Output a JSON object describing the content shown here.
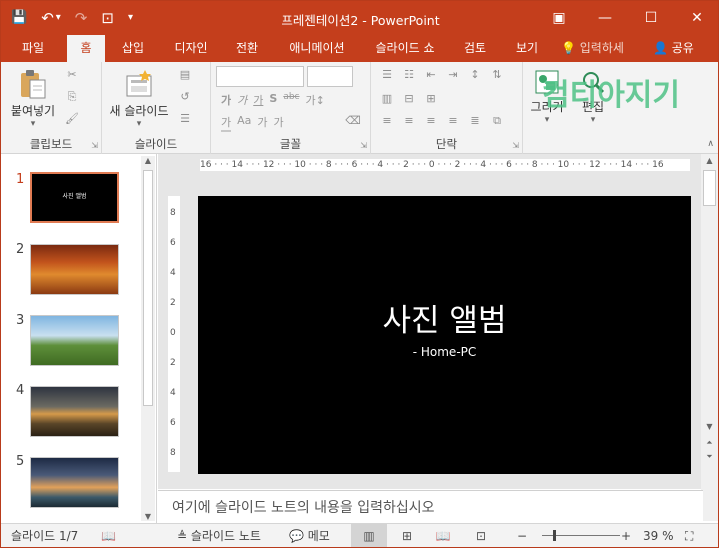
{
  "window": {
    "title": "프레젠테이션2  -  PowerPoint",
    "controls": {
      "restore_ribbon": "▣",
      "minimize": "—",
      "maximize": "☐",
      "close": "✕"
    }
  },
  "qat": {
    "save": "💾",
    "undo": "↶",
    "undo_dd": "▾",
    "redo": "↷",
    "present": "⊡",
    "customize": "▾"
  },
  "tabs": [
    {
      "label": "파일"
    },
    {
      "label": "홈"
    },
    {
      "label": "삽입"
    },
    {
      "label": "디자인"
    },
    {
      "label": "전환"
    },
    {
      "label": "애니메이션"
    },
    {
      "label": "슬라이드 쇼"
    },
    {
      "label": "검토"
    },
    {
      "label": "보기"
    }
  ],
  "tellme": "💡 입력하세",
  "share": "👤 공유",
  "ribbon": {
    "clipboard": {
      "label": "클립보드",
      "paste_label": "붙여넣기"
    },
    "slides": {
      "label": "슬라이드",
      "new_slide_label": "새 슬라이드"
    },
    "font": {
      "label": "글꼴",
      "row1": [
        "가",
        "가",
        "가",
        "S",
        "abc",
        "가↕"
      ],
      "row2": [
        "가",
        "Aa",
        "가",
        "가"
      ]
    },
    "paragraph": {
      "label": "단락"
    },
    "drawing": {
      "draw_label": "그리기",
      "edit_label": "편집"
    }
  },
  "thumbnails": [
    {
      "num": "1",
      "selected": true,
      "kind": "title",
      "text": "사진 앨범"
    },
    {
      "num": "2",
      "selected": false,
      "kind": "autumn"
    },
    {
      "num": "3",
      "selected": false,
      "kind": "field"
    },
    {
      "num": "4",
      "selected": false,
      "kind": "sunset"
    },
    {
      "num": "5",
      "selected": false,
      "kind": "clouds"
    }
  ],
  "ruler": {
    "h": "16 · · · 14 · · · 12 · · · 10 · · · 8 · · · 6 · · · 4 · · · 2 · · · 0 · · · 2 · · · 4 · · · 6 · · · 8 · · · 10 · · · 12 · · · 14 · · · 16",
    "v": [
      "8",
      "6",
      "4",
      "2",
      "0",
      "2",
      "4",
      "6",
      "8"
    ]
  },
  "slide": {
    "title": "사진 앨범",
    "subtitle": "- Home-PC"
  },
  "notes_placeholder": "여기에 슬라이드 노트의 내용을 입력하십시오",
  "status": {
    "slide_info": "슬라이드 1/7",
    "notes_btn": "≜ 슬라이드 노트",
    "comments_btn": "💬 메모",
    "zoom_minus": "−",
    "zoom_plus": "+",
    "zoom_pct": "39 %",
    "zoom_value": 39
  },
  "watermark": "컴티아지기",
  "colors": {
    "accent": "#c43e1c",
    "ribbon_bg": "#f3f3f3"
  }
}
